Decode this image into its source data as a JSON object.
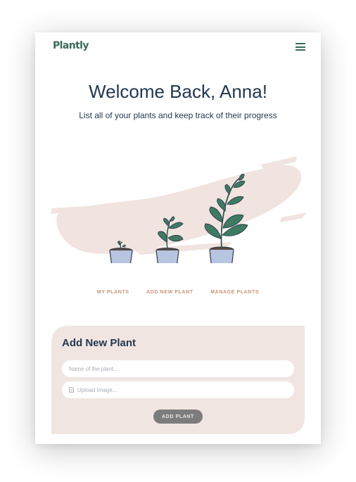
{
  "brand": {
    "logo": "Plantly",
    "accent": "#3a6b58",
    "navy": "#23384f",
    "tan": "#c99476",
    "panel": "#f1e5e2"
  },
  "header": {
    "menu_icon": "hamburger-icon"
  },
  "hero": {
    "title": "Welcome Back, Anna!",
    "subtitle": "List all of your plants and keep track of their progress"
  },
  "nav": {
    "items": [
      {
        "label": "MY PLANTS"
      },
      {
        "label": "ADD NEW PLANT"
      },
      {
        "label": "MANAGE PLANTS"
      }
    ]
  },
  "form": {
    "title": "Add New Plant",
    "name_placeholder": "Name of the plant...",
    "upload_placeholder": "Upload Image...",
    "upload_icon": "file-icon",
    "submit_label": "ADD PLANT"
  }
}
